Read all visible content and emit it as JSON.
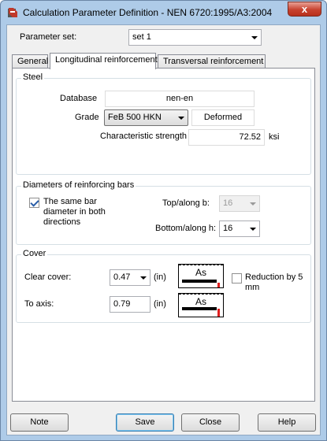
{
  "window": {
    "title": "Calculation Parameter Definition - NEN 6720:1995/A3:2004",
    "close_glyph": "x"
  },
  "param_set": {
    "label": "Parameter set:",
    "value": "set 1"
  },
  "tabs": [
    {
      "label": "General"
    },
    {
      "label": "Longitudinal reinforcement"
    },
    {
      "label": "Transversal reinforcement"
    }
  ],
  "steel": {
    "title": "Steel",
    "database_label": "Database",
    "database_value": "nen-en",
    "grade_label": "Grade",
    "grade_value": "FeB 500 HKN",
    "grade_type": "Deformed",
    "strength_label": "Characteristic strength",
    "strength_value": "72.52",
    "strength_unit": "ksi"
  },
  "diameters": {
    "title": "Diameters of reinforcing bars",
    "same_label_1": "The same bar",
    "same_label_2": "diameter in both",
    "same_label_3": "directions",
    "same_checked": true,
    "top_label": "Top/along b:",
    "top_value": "16",
    "bottom_label": "Bottom/along h:",
    "bottom_value": "16"
  },
  "cover": {
    "title": "Cover",
    "clear_label": "Clear cover:",
    "clear_value": "0.47",
    "clear_unit": "(in)",
    "axis_label": "To axis:",
    "axis_value": "0.79",
    "axis_unit": "(in)",
    "as_symbol": "As",
    "reduction_label_1": "Reduction by 5",
    "reduction_label_2": "mm",
    "reduction_checked": false
  },
  "buttons": {
    "note": "Note",
    "save": "Save",
    "close": "Close",
    "help": "Help"
  }
}
